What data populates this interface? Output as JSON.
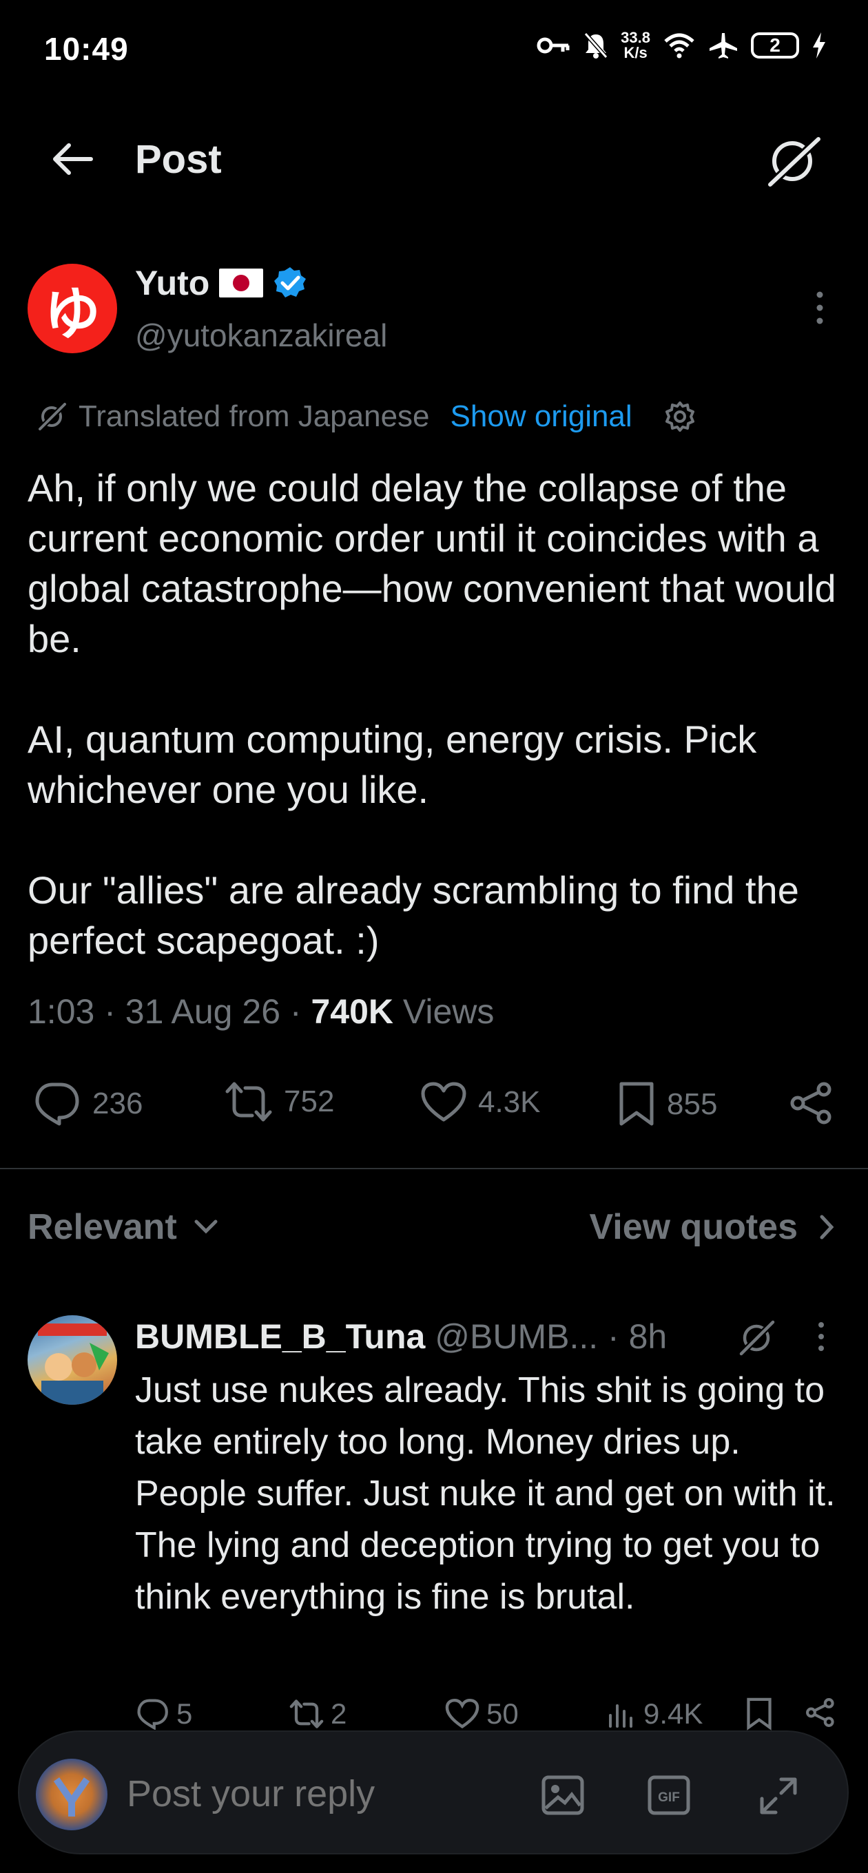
{
  "status_bar": {
    "time": "10:49",
    "speed_value": "33.8",
    "speed_unit": "K/s",
    "network": "6",
    "battery": "2"
  },
  "header": {
    "title": "Post"
  },
  "post": {
    "author_name": "Yuto",
    "author_handle": "@yutokanzakireal",
    "avatar_char": "ゆ",
    "translated_label": "Translated from Japanese",
    "show_original_label": "Show original",
    "body": "Ah, if only we could delay the collapse of the current economic order until it coincides with a global catastrophe—how convenient that would be.\n\nAI, quantum computing, energy crisis. Pick whichever one you like.\n\nOur \"allies\" are already scrambling to find the perfect scapegoat. :)",
    "time": "1:03",
    "date": "31 Aug 26",
    "views_count": "740K",
    "views_label": "Views",
    "replies": "236",
    "reposts": "752",
    "likes": "4.3K",
    "bookmarks": "855"
  },
  "sort": {
    "relevant_label": "Relevant",
    "view_quotes_label": "View quotes"
  },
  "reply": {
    "name": "BUMBLE_B_Tuna",
    "handle": "@BUMB...",
    "time": "8h",
    "body": "Just use nukes already. This shit is going to take entirely too long. Money dries up. People suffer. Just nuke it and get on with it. The lying and deception trying to get you to think everything is fine is brutal.",
    "replies": "5",
    "reposts": "2",
    "likes": "50",
    "views": "9.4K"
  },
  "composer": {
    "placeholder": "Post your reply"
  },
  "colors": {
    "accent": "#1d9bf0",
    "muted": "#71767b",
    "text": "#e7e9ea",
    "avatar_red": "#f4211b"
  }
}
